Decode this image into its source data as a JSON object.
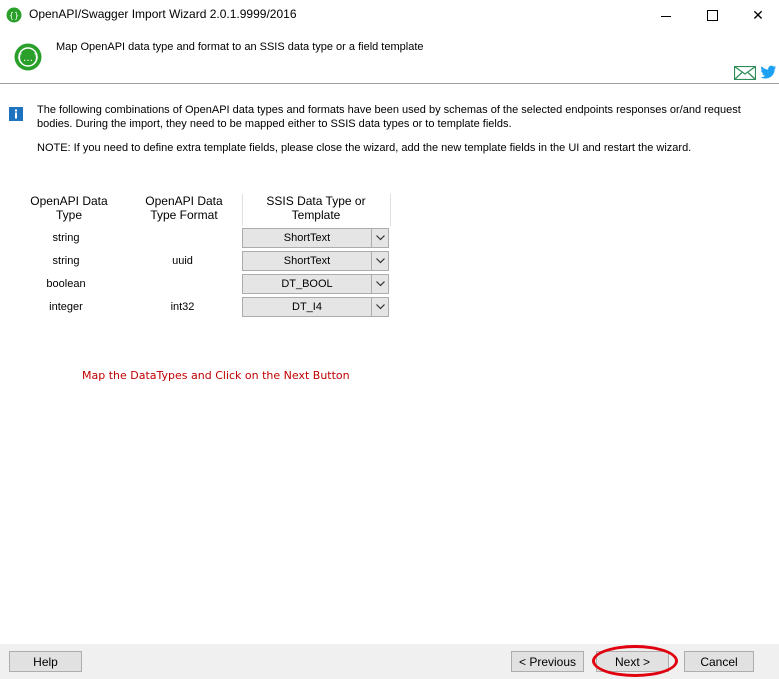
{
  "window": {
    "title": "OpenAPI/Swagger Import Wizard 2.0.1.9999/2016",
    "controls": {
      "minimize": "minimize-icon",
      "maximize": "maximize-icon",
      "close": "✕"
    }
  },
  "header": {
    "text": "Map OpenAPI data type and format to an SSIS data type or a field template",
    "icons": [
      "mail-icon",
      "twitter-icon"
    ],
    "accent": "#2aa02a"
  },
  "info": {
    "description": "The following combinations of OpenAPI data types and formats have been used by schemas of the selected endpoints responses or/and request bodies. During the import, they need to be mapped either to SSIS data types or to template fields.",
    "note": "NOTE: If you need to define extra template fields, please close the wizard, add the new template fields in the UI and restart the wizard."
  },
  "grid": {
    "headers": [
      "OpenAPI Data Type",
      "OpenAPI Data Type Format",
      "SSIS Data Type or Template"
    ],
    "rows": [
      {
        "type": "string",
        "format": "",
        "mapping": "ShortText"
      },
      {
        "type": "string",
        "format": "uuid",
        "mapping": "ShortText"
      },
      {
        "type": "boolean",
        "format": "",
        "mapping": "DT_BOOL"
      },
      {
        "type": "integer",
        "format": "int32",
        "mapping": "DT_I4"
      }
    ]
  },
  "hint": {
    "text": "Map the DataTypes and Click on the Next Button",
    "color": "#c00000"
  },
  "footer": {
    "help": "Help",
    "previous": "< Previous",
    "next": "Next >",
    "cancel": "Cancel",
    "highlight_color": "#e0000e"
  }
}
